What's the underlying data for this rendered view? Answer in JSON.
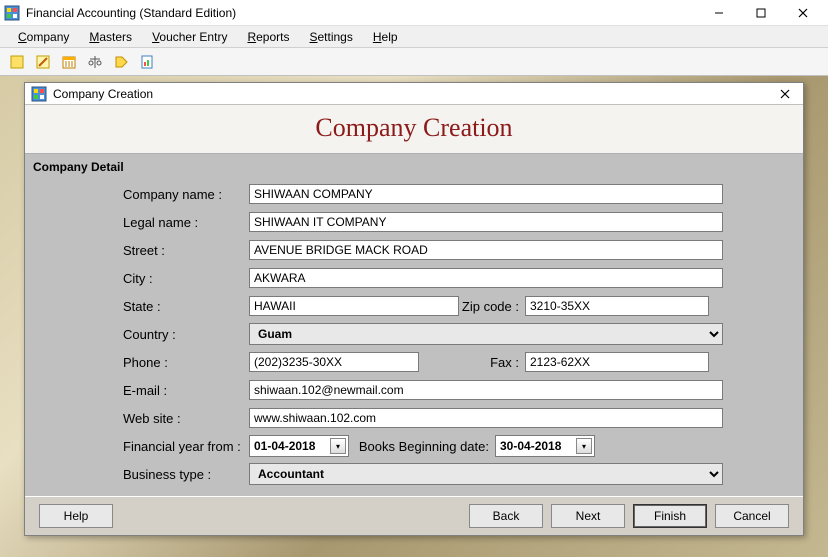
{
  "app": {
    "title": "Financial Accounting (Standard Edition)"
  },
  "menu": {
    "company": "Company",
    "masters": "Masters",
    "voucher": "Voucher Entry",
    "reports": "Reports",
    "settings": "Settings",
    "help": "Help"
  },
  "dialog": {
    "title": "Company Creation",
    "heading": "Company Creation",
    "section": "Company Detail"
  },
  "labels": {
    "company_name": "Company name :",
    "legal_name": "Legal name :",
    "street": "Street :",
    "city": "City :",
    "state": "State :",
    "zip": "Zip code :",
    "country": "Country :",
    "phone": "Phone :",
    "fax": "Fax :",
    "email": "E-mail :",
    "website": "Web site :",
    "fin_year": "Financial year from :",
    "books_begin": "Books Beginning date:",
    "biz_type": "Business type :"
  },
  "values": {
    "company_name": "SHIWAAN COMPANY",
    "legal_name": "SHIWAAN IT COMPANY",
    "street": "AVENUE BRIDGE MACK ROAD",
    "city": "AKWARA",
    "state": "HAWAII",
    "zip": "3210-35XX",
    "country": "Guam",
    "phone": "(202)3235-30XX",
    "fax": "2123-62XX",
    "email": "shiwaan.102@newmail.com",
    "website": "www.shiwaan.102.com",
    "fin_year": "01-04-2018",
    "books_begin": "30-04-2018",
    "biz_type": "Accountant"
  },
  "buttons": {
    "help": "Help",
    "back": "Back",
    "next": "Next",
    "finish": "Finish",
    "cancel": "Cancel"
  }
}
